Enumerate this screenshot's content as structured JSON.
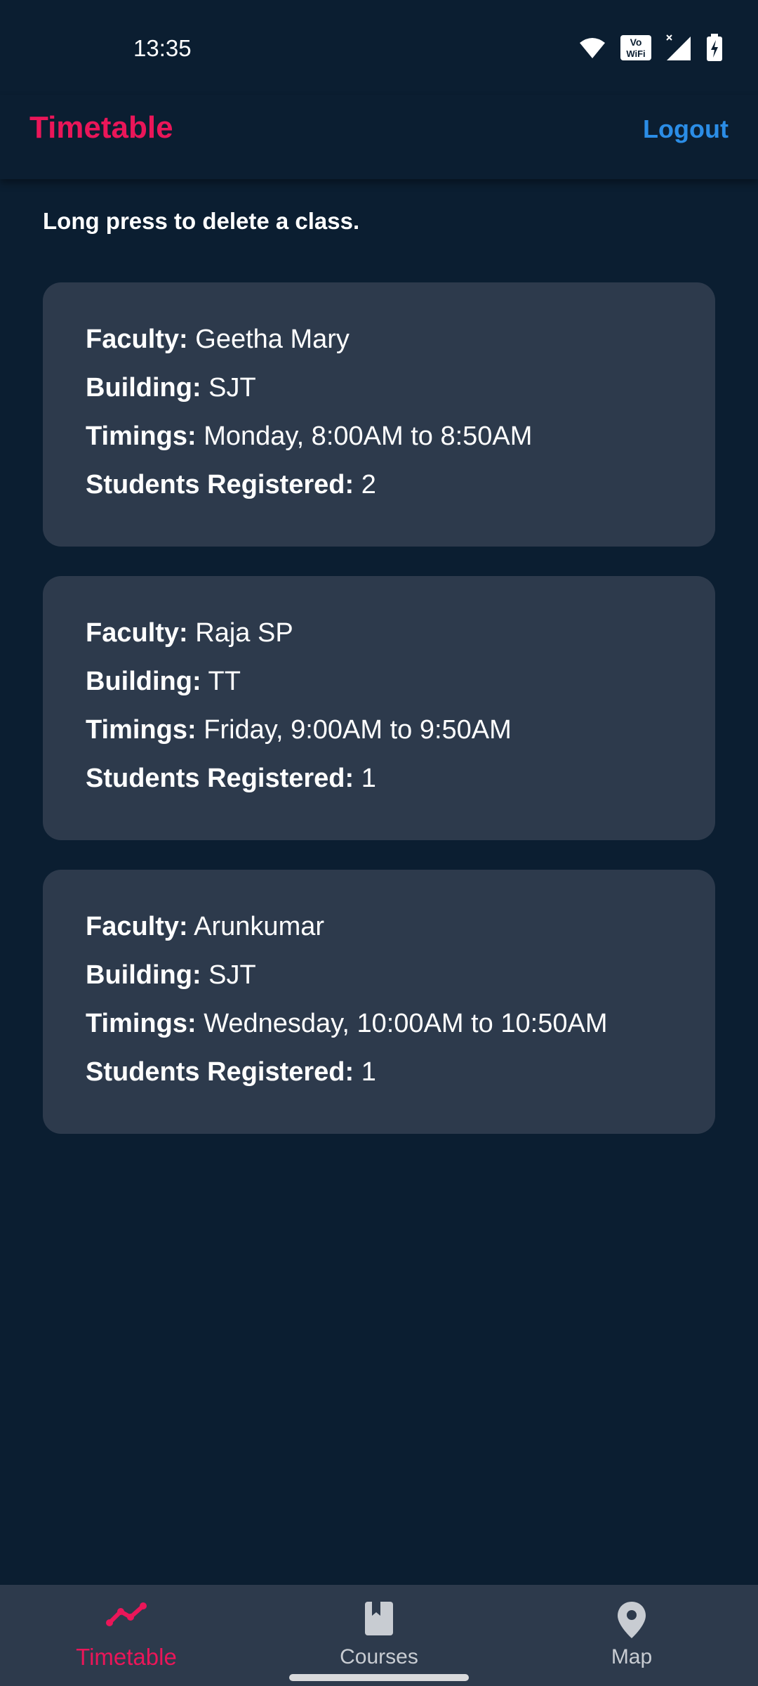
{
  "status_bar": {
    "time": "13:35",
    "icons": [
      "wifi-icon",
      "vowifi-icon",
      "signal-icon",
      "battery-charging-icon"
    ],
    "vowifi_text_top": "Vo",
    "vowifi_text_bottom": "WiFi"
  },
  "app_bar": {
    "title": "Timetable",
    "logout_label": "Logout"
  },
  "hint": "Long press to delete a class.",
  "labels": {
    "faculty": "Faculty:",
    "building": "Building:",
    "timings": "Timings:",
    "students": "Students Registered:"
  },
  "classes": [
    {
      "faculty": " Geetha Mary",
      "building": " SJT",
      "timings": " Monday, 8:00AM to 8:50AM",
      "students": " 2"
    },
    {
      "faculty": " Raja SP",
      "building": " TT",
      "timings": " Friday, 9:00AM to 9:50AM",
      "students": " 1"
    },
    {
      "faculty": " Arunkumar",
      "building": " SJT",
      "timings": " Wednesday, 10:00AM to 10:50AM",
      "students": " 1"
    }
  ],
  "bottom_nav": [
    {
      "label": "Timetable",
      "icon": "trending-line-icon",
      "active": true
    },
    {
      "label": "Courses",
      "icon": "book-icon",
      "active": false
    },
    {
      "label": "Map",
      "icon": "map-pin-icon",
      "active": false
    }
  ],
  "colors": {
    "background": "#0b1e31",
    "card": "#2d3a4c",
    "accent": "#ea1659",
    "link": "#2b8de6"
  }
}
